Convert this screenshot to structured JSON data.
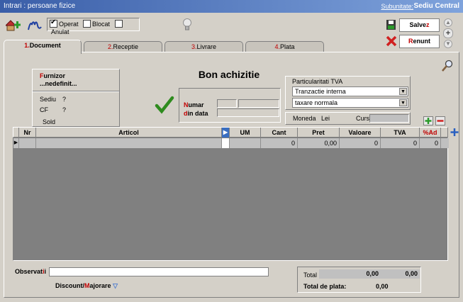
{
  "window": {
    "title": "Intrari : persoane fizice",
    "subunitate_label": "Subunitate:",
    "subunitate_value": "Sediu Central"
  },
  "toolbar": {
    "operat_label": "Operat",
    "operat_checked": true,
    "blocat_label": "Blocat",
    "blocat_checked": false,
    "anulat_label": "Anulat",
    "anulat_checked": false,
    "salvez_prefix": "Salve",
    "salvez_hotkey": "z",
    "renunt_hotkey": "R",
    "renunt_rest": "enunt"
  },
  "tabs": [
    {
      "num": "1.",
      "label": "Document",
      "active": true
    },
    {
      "num": "2.",
      "label": "Receptie",
      "active": false
    },
    {
      "num": "3.",
      "label": "Livrare",
      "active": false
    },
    {
      "num": "4.",
      "label": "Plata",
      "active": false
    }
  ],
  "furnizor": {
    "label_hotkey": "F",
    "label_rest": "urnizor",
    "value": "...nedefinit...",
    "sediu_label": "Sediu",
    "sediu_value": "?",
    "cf_label": "CF",
    "cf_value": "?",
    "sold_label": "Sold"
  },
  "document": {
    "heading": "Bon achizitie",
    "numar_hotkey": "N",
    "numar_rest": "umar",
    "data_hotkey": "d",
    "data_rest": "in data"
  },
  "tva": {
    "group_label": "Particularitati TVA",
    "option1": "Tranzactie interna",
    "option2": "taxare normala"
  },
  "moneda": {
    "label": "Moneda",
    "value": "Lei",
    "curs_label": "Curs"
  },
  "grid": {
    "columns": [
      "Nr",
      "Articol",
      "UM",
      "Cant",
      "Pret",
      "Valoare",
      "TVA",
      "%Ad"
    ],
    "row": {
      "nr": "",
      "articol": "",
      "um": "",
      "cant": "0",
      "pret": "0,00",
      "valoare": "0",
      "tva": "0",
      "ad": "0"
    }
  },
  "footer": {
    "observatii_prefix": "Observat",
    "observatii_hotkey": "i",
    "observatii_suffix": "i",
    "discount_prefix": "Discount/",
    "discount_hotkey": "M",
    "discount_rest": "ajorare",
    "total_label": "Total",
    "total_value1": "0,00",
    "total_value2": "0,00",
    "total_plata_label": "Total de plata:",
    "total_plata_value": "0,00"
  },
  "colors": {
    "title_gradient_start": "#3a5ea8",
    "title_gradient_end": "#7fa3dc",
    "accent_red": "#c00000",
    "check_green": "#2e8b1e"
  }
}
